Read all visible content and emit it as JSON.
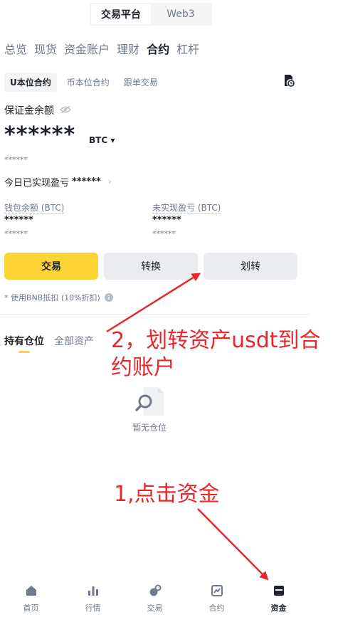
{
  "top_switch": {
    "platform": "交易平台",
    "web3": "Web3"
  },
  "main_tabs": [
    "总览",
    "现货",
    "资金账户",
    "理财",
    "合约",
    "杠杆"
  ],
  "sub_tabs": [
    "U本位合约",
    "币本位合约",
    "跟单交易"
  ],
  "margin_balance": {
    "label": "保证金余额",
    "value": "******",
    "unit": "BTC ▾",
    "sub": "******"
  },
  "realized_pnl": {
    "label": "今日已实现盈亏",
    "value": "******",
    "chevron": "›"
  },
  "wallet_balance": {
    "label": "钱包余额 (BTC)",
    "value": "******",
    "sub": "******"
  },
  "unrealized_pnl": {
    "label": "未实现盈亏 (BTC)",
    "value": "******",
    "sub": "******"
  },
  "buttons": {
    "trade": "交易",
    "convert": "转换",
    "transfer": "划转"
  },
  "note": "* 使用BNB抵扣 (10%折扣)",
  "position_tabs": [
    "持有仓位",
    "全部资产"
  ],
  "empty_state": "暂无仓位",
  "annotations": {
    "step2": "2，划转资产usdt到合约账户",
    "step1": "1,点击资金"
  },
  "bottom_nav": [
    "首页",
    "行情",
    "交易",
    "合约",
    "资金"
  ],
  "colors": {
    "accent": "#fcd535",
    "annotation": "#e8272a",
    "text": "#1e2329",
    "muted": "#707a8a"
  }
}
